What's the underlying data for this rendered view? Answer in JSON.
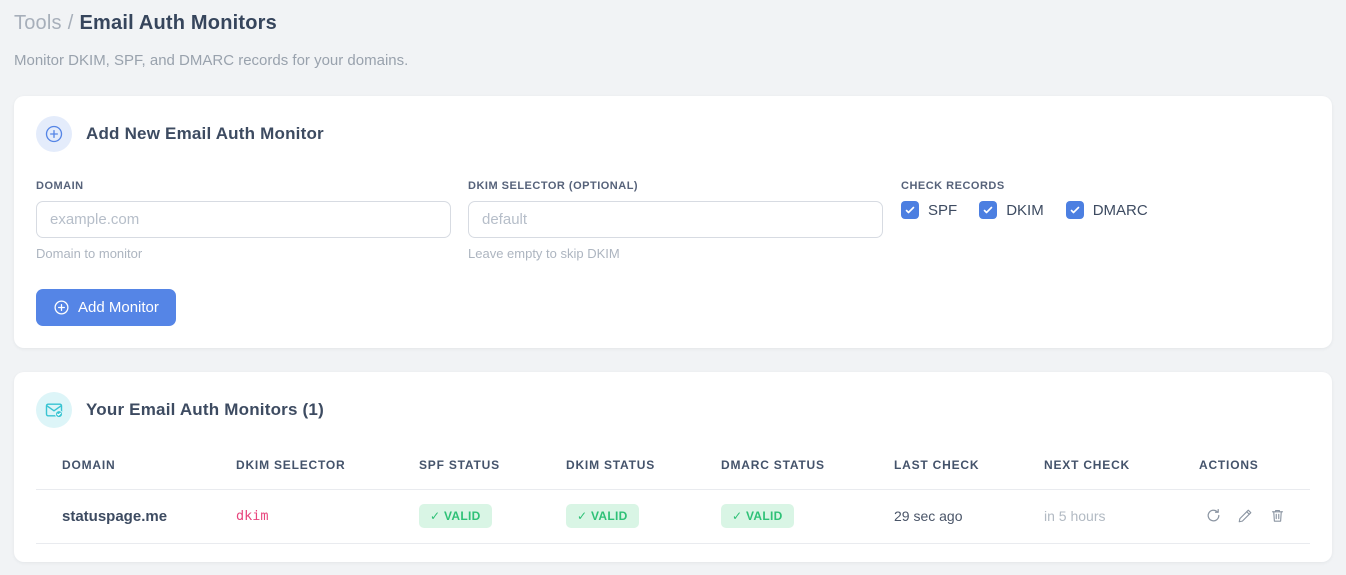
{
  "page": {
    "breadcrumb": {
      "section": "Tools",
      "separator": "/",
      "current": "Email Auth Monitors"
    },
    "subtitle": "Monitor DKIM, SPF, and DMARC records for your domains."
  },
  "add_monitor_card": {
    "title": "Add New Email Auth Monitor",
    "fields": {
      "domain": {
        "label": "DOMAIN",
        "placeholder": "example.com",
        "value": "",
        "helper": "Domain to monitor"
      },
      "dkim_selector": {
        "label": "DKIM SELECTOR (OPTIONAL)",
        "placeholder": "default",
        "value": "",
        "helper": "Leave empty to skip DKIM"
      }
    },
    "check_records": {
      "label": "CHECK RECORDS",
      "options": [
        {
          "label": "SPF",
          "checked": true
        },
        {
          "label": "DKIM",
          "checked": true
        },
        {
          "label": "DMARC",
          "checked": true
        }
      ]
    },
    "submit_label": "Add Monitor"
  },
  "monitors_card": {
    "title": "Your Email Auth Monitors (1)",
    "count": 1,
    "table": {
      "headers": [
        "DOMAIN",
        "DKIM SELECTOR",
        "SPF STATUS",
        "DKIM STATUS",
        "DMARC STATUS",
        "LAST CHECK",
        "NEXT CHECK",
        "ACTIONS"
      ],
      "rows": [
        {
          "domain": "statuspage.me",
          "dkim_selector": "dkim",
          "spf_status": "✓ VALID",
          "dkim_status": "✓ VALID",
          "dmarc_status": "✓ VALID",
          "last_check": "29 sec ago",
          "next_check": "in 5 hours",
          "actions": [
            "refresh",
            "edit",
            "delete"
          ]
        }
      ]
    }
  },
  "colors": {
    "accent_blue": "#5585e6",
    "checkbox_blue": "#4c7fe1",
    "teal": "#38c4d2",
    "valid_green": "#2fc177",
    "valid_green_bg": "#d9f5e5",
    "selector_pink": "#e8457d",
    "page_bg": "#f1f3f5"
  }
}
